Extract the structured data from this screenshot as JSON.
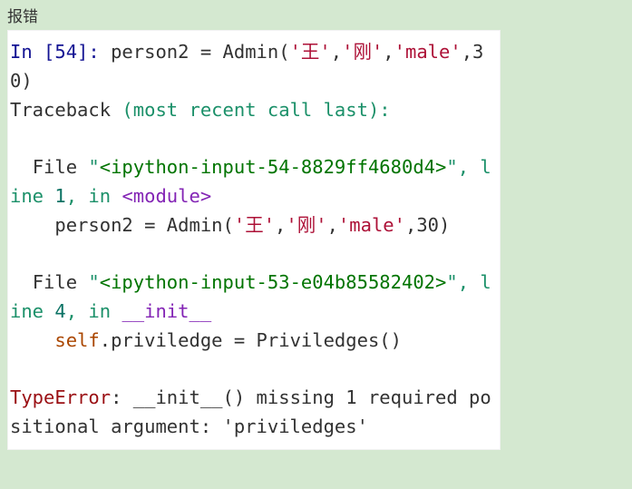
{
  "title": "报错",
  "code": {
    "prompt": "In [54]: ",
    "assign": "person2 = Admin(",
    "s1": "'王'",
    "comma1": ",",
    "s2": "'刚'",
    "comma2": ",",
    "s3": "'male'",
    "tail": ",30)",
    "traceback_word": "Traceback",
    "traceback_paren": " (most recent call last):",
    "file_word1": "  File ",
    "quote_open1": "\"",
    "input_ref1": "<ipython-input-54-8829ff4680d4>",
    "after_ref1": "\", line ",
    "line_num1": "1",
    "in_word1": ", in ",
    "module_ref": "<module>",
    "replay_indent": "    ",
    "replay_assign": "person2 = Admin(",
    "rs1": "'王'",
    "rcomma1": ",",
    "rs2": "'刚'",
    "rcomma2": ",",
    "rs3": "'male'",
    "rtail": ",30)",
    "file_word2": "  File ",
    "quote_open2": "\"",
    "input_ref2": "<ipython-input-53-e04b85582402>",
    "after_ref2": "\", line ",
    "line_num2": "4",
    "in_word2": ", in ",
    "init_ref": "__init__",
    "priv_indent": "    ",
    "priv_self": "self",
    "priv_dot": ".priviledge = Priviledges()",
    "typeerror": "TypeError",
    "err_colon": ": __init__() missing 1 required positional argument: 'priviledges'"
  }
}
